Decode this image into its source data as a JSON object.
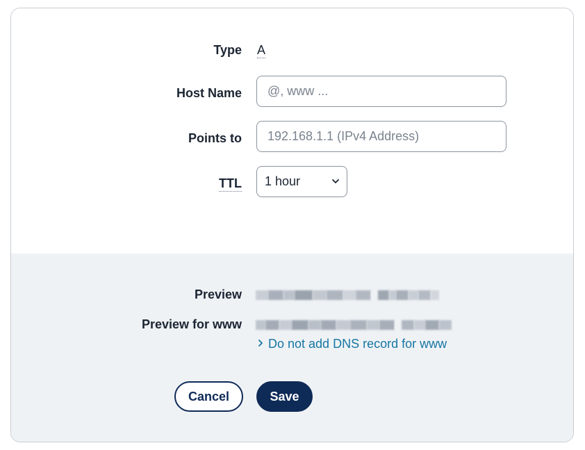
{
  "form": {
    "type_label": "Type",
    "type_value": "A",
    "host_label": "Host Name",
    "host_placeholder": "@, www ...",
    "host_value": "",
    "points_label": "Points to",
    "points_placeholder": "192.168.1.1 (IPv4 Address)",
    "points_value": "",
    "ttl_label": "TTL",
    "ttl_selected": "1 hour"
  },
  "preview": {
    "preview_label": "Preview",
    "preview_www_label": "Preview for www",
    "preview_value_redacted": true,
    "preview_www_value_redacted": true,
    "no_www_link": "Do not add DNS record for www"
  },
  "actions": {
    "cancel_label": "Cancel",
    "save_label": "Save"
  },
  "colors": {
    "primary": "#0e2a57",
    "link": "#1676a3",
    "footer_bg": "#eff2f5",
    "text": "#1b2432"
  },
  "icons": {
    "select_chevron": "chevron-down-icon",
    "link_chevron": "chevron-right-icon"
  }
}
